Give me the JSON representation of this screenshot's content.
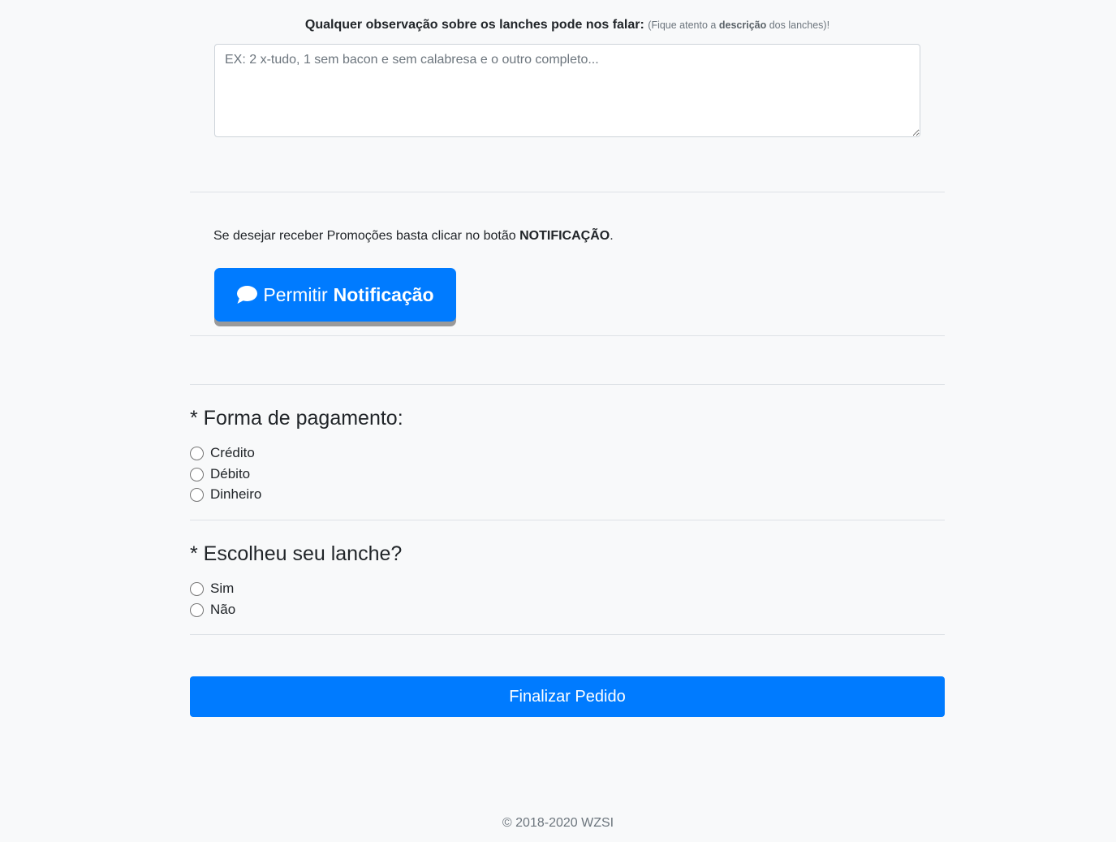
{
  "observation": {
    "label": "Qualquer observação sobre os lanches pode nos falar:",
    "hint_prefix": "(Fique atento a",
    "hint_bold": "descrição",
    "hint_suffix": "dos lanches)!",
    "placeholder": "EX: 2 x-tudo, 1 sem bacon e sem calabresa e o outro completo..."
  },
  "notification": {
    "text_prefix": "Se desejar receber Promoções basta clicar no botão",
    "text_bold": "NOTIFICAÇÃO",
    "text_suffix": ".",
    "button_label": "Permitir",
    "button_label_bold": "Notificação",
    "icon": "comment-icon"
  },
  "payment": {
    "title": "* Forma de pagamento:",
    "options": [
      "Crédito",
      "Débito",
      "Dinheiro"
    ]
  },
  "lanche": {
    "title": "* Escolheu seu lanche?",
    "options": [
      "Sim",
      "Não"
    ]
  },
  "submit": {
    "label": "Finalizar Pedido"
  },
  "footer": {
    "text": "© 2018-2020 WZSI"
  },
  "colors": {
    "primary": "#007bff",
    "background": "#f8f9fa",
    "divider": "#dee2e6"
  }
}
